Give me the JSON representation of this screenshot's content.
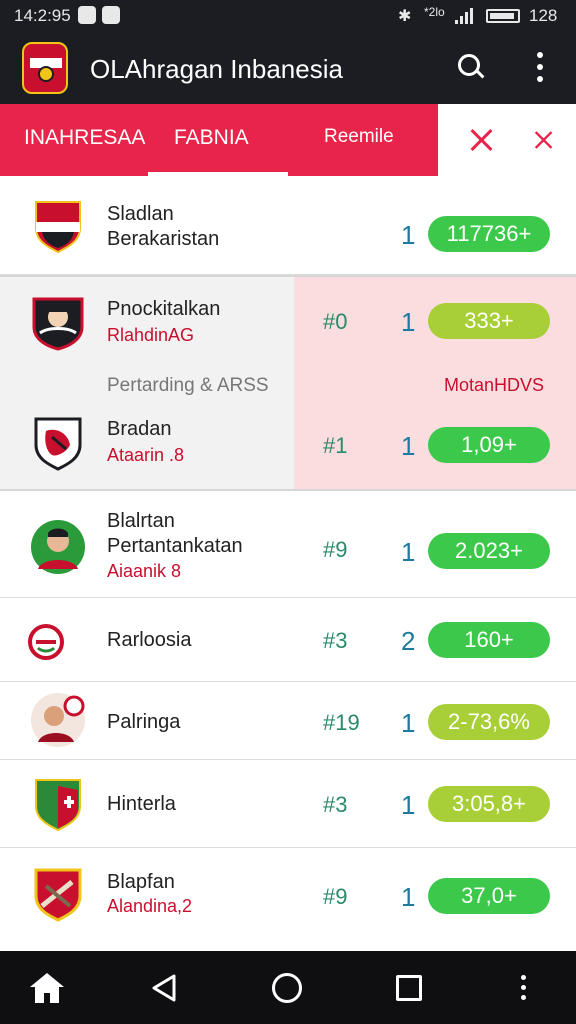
{
  "status_bar": {
    "time": "14:2:95",
    "signal_text": "*2lo",
    "battery_text": "128",
    "icons": [
      "notification-icon",
      "app-icon",
      "bluetooth-icon",
      "signal-icon",
      "battery-icon"
    ]
  },
  "app_bar": {
    "title": "OLAhragan Inbanesia",
    "icons": [
      "app-logo",
      "search-icon",
      "more-icon"
    ]
  },
  "tabs": [
    {
      "label": "INAHRESAA"
    },
    {
      "label": "FABNIA",
      "selected": true
    },
    {
      "label": "Reemile"
    }
  ],
  "colors": {
    "accent_red": "#e8244a",
    "pill_green": "#3cc94b",
    "pill_lime": "#a9cf38",
    "highlight_pink": "#fbdcdf"
  },
  "list": {
    "rows": [
      {
        "name": [
          "Sladlan",
          "Berakaristan"
        ],
        "sub": "",
        "rank": "",
        "num": "1",
        "value": "117736+",
        "pill": "green"
      },
      {
        "name": [
          "Pnockitalkan"
        ],
        "sub": "RlahdinAG",
        "rank": "#0",
        "num": "1",
        "value": "333+",
        "pill": "lime"
      },
      {
        "name": [
          "Bradan"
        ],
        "sub": "Ataarin .8",
        "rank": "#1",
        "num": "1",
        "value": "1,09+",
        "pill": "green"
      },
      {
        "name": [
          "Blalrtan",
          "Pertantankatan"
        ],
        "sub": "Aiaanik 8",
        "rank": "#9",
        "num": "1",
        "value": "2.023+",
        "pill": "green"
      },
      {
        "name": [
          "Rarloosia"
        ],
        "sub": "",
        "rank": "#3",
        "num": "2",
        "value": "160+",
        "pill": "green"
      },
      {
        "name": [
          "Palringa"
        ],
        "sub": "",
        "rank": "#19",
        "num": "1",
        "value": "2-73,6%",
        "pill": "lime"
      },
      {
        "name": [
          "Hinterla"
        ],
        "sub": "",
        "rank": "#3",
        "num": "1",
        "value": "3:05,8+",
        "pill": "lime"
      },
      {
        "name": [
          "Blapfan"
        ],
        "sub": "Alandina,2",
        "rank": "#9",
        "num": "1",
        "value": "37,0+",
        "pill": "green"
      }
    ],
    "section_label": "Pertarding & ARSS",
    "section_right": "MotanHDVS"
  },
  "nav_bar": {
    "icons": [
      "home-icon",
      "back-icon",
      "home-circle-icon",
      "recents-icon",
      "more-icon"
    ]
  }
}
